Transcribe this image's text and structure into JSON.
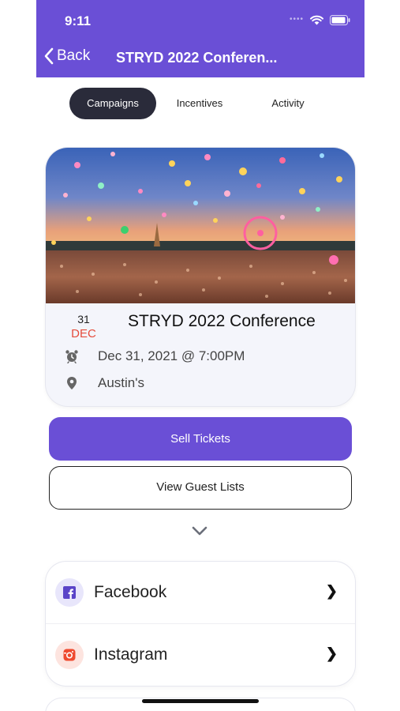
{
  "status_bar": {
    "time": "9:11"
  },
  "nav": {
    "back_label": "Back",
    "title": "STRYD 2022 Conferen..."
  },
  "tabs": [
    {
      "label": "Campaigns",
      "active": true
    },
    {
      "label": "Incentives",
      "active": false
    },
    {
      "label": "Activity",
      "active": false
    }
  ],
  "event": {
    "date_day": "31",
    "date_month": "DEC",
    "title": "STRYD 2022 Conference",
    "datetime": "Dec 31, 2021 @ 7:00PM",
    "location": "Austin's"
  },
  "actions": {
    "sell_tickets": "Sell Tickets",
    "view_guest_lists": "View Guest Lists"
  },
  "social": [
    {
      "label": "Facebook",
      "icon": "facebook-icon"
    },
    {
      "label": "Instagram",
      "icon": "instagram-icon"
    }
  ],
  "colors": {
    "brand": "#6a4fd6",
    "date_month": "#e54c3c",
    "tab_active": "#2a2b3a"
  }
}
